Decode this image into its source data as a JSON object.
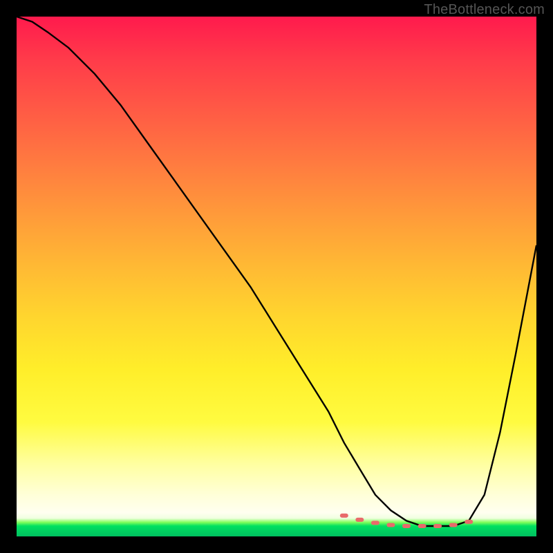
{
  "watermark": "TheBottleneck.com",
  "colors": {
    "background": "#000000",
    "curve": "#000000",
    "marker": "#e86a6a",
    "watermark": "#555555"
  },
  "chart_data": {
    "type": "line",
    "title": "",
    "xlabel": "",
    "ylabel": "",
    "xlim": [
      0,
      100
    ],
    "ylim": [
      0,
      100
    ],
    "grid": false,
    "series": [
      {
        "name": "bottleneck-curve",
        "x": [
          0,
          3,
          6,
          10,
          15,
          20,
          25,
          30,
          35,
          40,
          45,
          50,
          55,
          60,
          63,
          66,
          69,
          72,
          75,
          78,
          81,
          84,
          87,
          90,
          93,
          96,
          100
        ],
        "values": [
          100,
          99,
          97,
          94,
          89,
          83,
          76,
          69,
          62,
          55,
          48,
          40,
          32,
          24,
          18,
          13,
          8,
          5,
          3,
          2,
          2,
          2,
          3,
          8,
          20,
          35,
          56
        ]
      }
    ],
    "markers": {
      "name": "optimal-range",
      "x": [
        63,
        66,
        69,
        72,
        75,
        78,
        81,
        84,
        87
      ],
      "values": [
        4.0,
        3.2,
        2.6,
        2.2,
        2.0,
        2.0,
        2.0,
        2.2,
        2.8
      ]
    },
    "gradient_stops": [
      {
        "pos": 0,
        "color": "#ff1a4d"
      },
      {
        "pos": 0.5,
        "color": "#ffd62e"
      },
      {
        "pos": 0.95,
        "color": "#fffff0"
      },
      {
        "pos": 0.98,
        "color": "#00e060"
      },
      {
        "pos": 1.0,
        "color": "#00c060"
      }
    ]
  }
}
